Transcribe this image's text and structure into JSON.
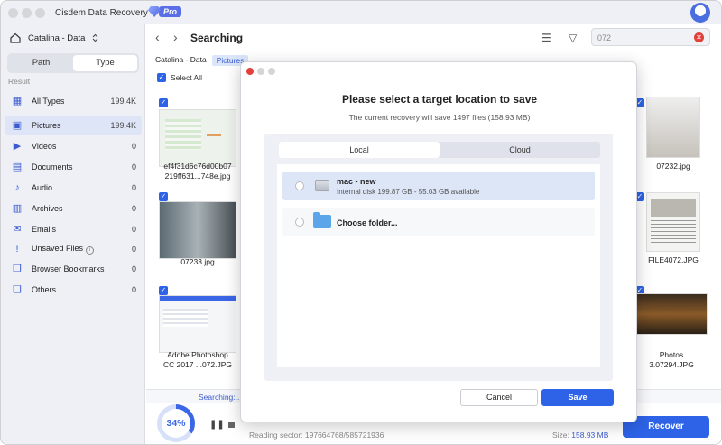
{
  "app": {
    "title": "Cisdem Data Recovery",
    "badge": "Pro"
  },
  "sidebar": {
    "disk": "Catalina - Data",
    "segments": [
      "Path",
      "Type"
    ],
    "result_label": "Result",
    "items": [
      {
        "label": "All Types",
        "count": "199.4K",
        "icon": "grid-icon"
      },
      {
        "label": "Pictures",
        "count": "199.4K",
        "icon": "image-icon"
      },
      {
        "label": "Videos",
        "count": "0",
        "icon": "video-icon"
      },
      {
        "label": "Documents",
        "count": "0",
        "icon": "document-icon"
      },
      {
        "label": "Audio",
        "count": "0",
        "icon": "music-icon"
      },
      {
        "label": "Archives",
        "count": "0",
        "icon": "archive-icon"
      },
      {
        "label": "Emails",
        "count": "0",
        "icon": "mail-icon"
      },
      {
        "label": "Unsaved Files",
        "count": "0",
        "icon": "unsaved-icon"
      },
      {
        "label": "Browser Bookmarks",
        "count": "0",
        "icon": "bookmark-icon"
      },
      {
        "label": "Others",
        "count": "0",
        "icon": "others-icon"
      }
    ]
  },
  "main": {
    "title": "Searching",
    "search_value": "072",
    "breadcrumb": [
      "Catalina - Data",
      "Pictures"
    ],
    "select_all": "Select All",
    "thumbs_left": [
      {
        "name": "ef4f31d6c76d00b07\n219ff631...748e.jpg"
      },
      {
        "name": "07233.jpg"
      },
      {
        "name": "Adobe Photoshop\nCC 2017 ...072.JPG"
      }
    ],
    "thumbs_right": [
      {
        "name": "07232.jpg"
      },
      {
        "name": "FILE4072.JPG"
      },
      {
        "name": "Photos\n3.07294.JPG"
      }
    ]
  },
  "bottom": {
    "status": "Searching:..",
    "progress": "34%",
    "sector": "Reading sector: 197664768/585721936",
    "size_label": "Size:",
    "size_value": "158.93 MB",
    "recover": "Recover"
  },
  "dialog": {
    "title": "Please select a target location to save",
    "subtitle": "The current recovery will save 1497 files (158.93 MB)",
    "tabs": [
      "Local",
      "Cloud"
    ],
    "locations": [
      {
        "name": "mac - new",
        "detail": "Internal disk 199.87 GB - 55.03 GB available"
      },
      {
        "name": "Choose folder..."
      }
    ],
    "cancel": "Cancel",
    "save": "Save"
  },
  "colors": {
    "accent": "#2e63e8",
    "close": "#e2403a"
  }
}
